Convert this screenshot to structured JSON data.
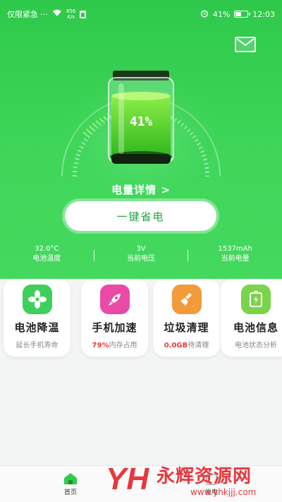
{
  "status_bar": {
    "notification_text": "仅限紧急 ···",
    "net_speed_value": "856",
    "net_speed_unit": "K/s",
    "battery_percent": "41%",
    "time": "12:03"
  },
  "header": {
    "mail_icon": "mail-icon"
  },
  "battery_gauge": {
    "level_percent": 41,
    "level_text": "41%",
    "accent": "#2ec94a"
  },
  "details_link": "电量详情 >",
  "charge_button": "一键省电",
  "stats": [
    {
      "value": "32.0°C",
      "label": "电池温度"
    },
    {
      "value": "3V",
      "label": "当前电压"
    },
    {
      "value": "1537mAh",
      "label": "当前电量"
    }
  ],
  "features": [
    {
      "icon": "fan-icon",
      "color": "#3ecf5c",
      "title": "电池降温",
      "sub_highlight": "",
      "sub": "延长手机寿命"
    },
    {
      "icon": "rocket-icon",
      "color": "#e94aa8",
      "title": "手机加速",
      "sub_highlight": "79%",
      "sub": "内存占用"
    },
    {
      "icon": "broom-icon",
      "color": "#f39a3a",
      "title": "垃圾清理",
      "sub_highlight": "0.0GB",
      "sub": "待清理"
    },
    {
      "icon": "battery-info-icon",
      "color": "#7ad44a",
      "title": "电池信息",
      "sub_highlight": "",
      "sub": "电池状态分析"
    }
  ],
  "tabbar": [
    {
      "icon": "home-icon",
      "label": "首页"
    },
    {
      "icon": "battery-tab-icon",
      "label": "省电"
    }
  ],
  "watermark": {
    "logo": "YH",
    "title": "永辉资源网",
    "url": "www.yhkjjj.com"
  }
}
